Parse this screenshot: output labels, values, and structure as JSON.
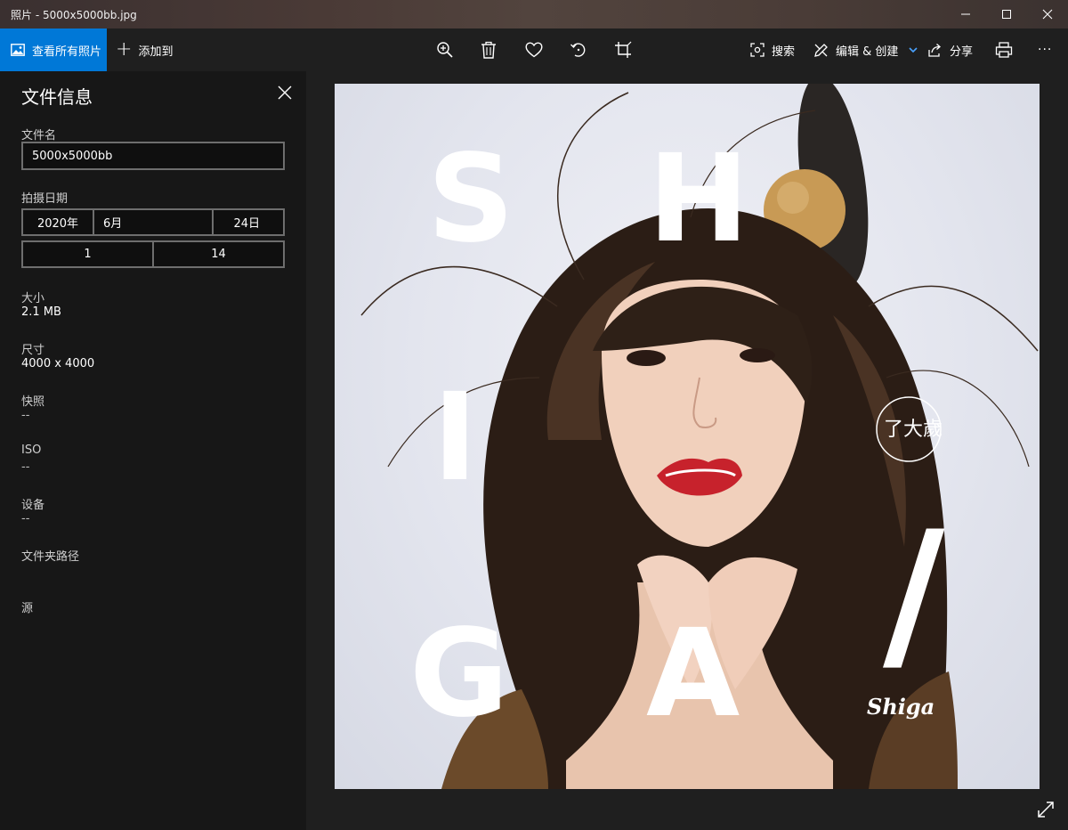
{
  "window": {
    "title": "照片 - 5000x5000bb.jpg"
  },
  "toolbar": {
    "view_all_label": "查看所有照片",
    "add_to_label": "添加到",
    "search_label": "搜索",
    "edit_create_label": "编辑 & 创建",
    "share_label": "分享",
    "more_label": "···",
    "accent_color": "#0078d7"
  },
  "panel": {
    "title": "文件信息",
    "filename_label": "文件名",
    "filename_value": "5000x5000bb",
    "date_label": "拍摄日期",
    "date_year": "2020年",
    "date_month": "6月",
    "date_day": "24日",
    "time_hour": "1",
    "time_minute": "14",
    "size_label": "大小",
    "size_value": "2.1 MB",
    "dimensions_label": "尺寸",
    "dimensions_value": "4000 x 4000",
    "exposure_label": "快照",
    "exposure_value": "--",
    "iso_label": "ISO",
    "iso_value": "--",
    "device_label": "设备",
    "device_value": "--",
    "folder_label": "文件夹路径",
    "source_label": "源"
  },
  "photo": {
    "letters": [
      "S",
      "H",
      "I",
      "G",
      "A",
      "/"
    ],
    "seal_text": "了大歲",
    "signature": "Shiga"
  }
}
